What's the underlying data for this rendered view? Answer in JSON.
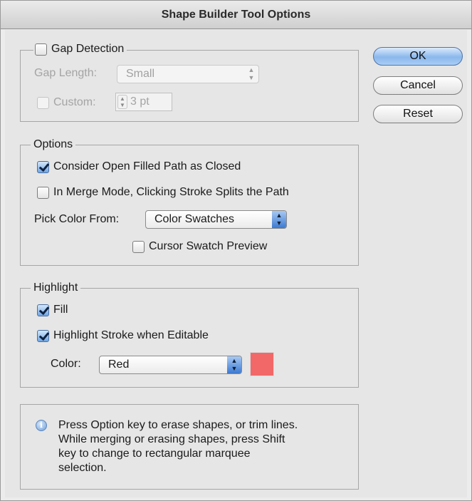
{
  "window": {
    "title": "Shape Builder Tool Options"
  },
  "gap_detection": {
    "label": "Gap Detection",
    "checked": false,
    "gap_length_label": "Gap Length:",
    "gap_length_value": "Small",
    "custom_label": "Custom:",
    "custom_value": "3 pt"
  },
  "options": {
    "legend": "Options",
    "open_filled_label": "Consider Open Filled Path as Closed",
    "merge_mode_label": "In Merge Mode, Clicking Stroke Splits the Path",
    "pick_color_label": "Pick Color From:",
    "pick_color_value": "Color Swatches",
    "cursor_preview_label": "Cursor Swatch Preview"
  },
  "highlight": {
    "legend": "Highlight",
    "fill_label": "Fill",
    "stroke_label": "Highlight Stroke when Editable",
    "color_label": "Color:",
    "color_value": "Red",
    "swatch_color": "#f26868"
  },
  "info": {
    "lines": [
      "Press Option key to erase shapes, or trim lines.",
      "While merging or erasing shapes, press Shift",
      "key to change to rectangular marquee",
      "selection."
    ]
  },
  "buttons": {
    "ok": "OK",
    "cancel": "Cancel",
    "reset": "Reset"
  }
}
